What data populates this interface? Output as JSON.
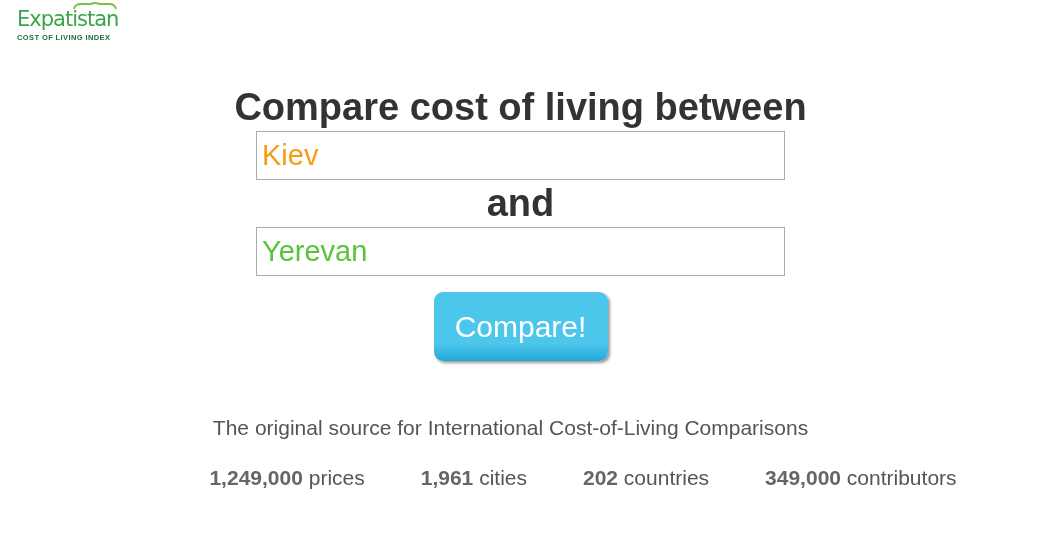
{
  "logo": {
    "name": "Expatistan",
    "tagline": "COST OF LIVING INDEX"
  },
  "title": "Compare cost of living between",
  "city_1": {
    "value": "Kiev",
    "color": "#f59c13"
  },
  "connector": "and",
  "city_2": {
    "value": "Yerevan",
    "color": "#5ac33a"
  },
  "compare_button": "Compare!",
  "subtitle": "The original source for International Cost-of-Living Comparisons",
  "stats": [
    "**1,249,000** prices",
    "**1,961** cities",
    "**202** countries",
    "**349,000** contributors"
  ]
}
